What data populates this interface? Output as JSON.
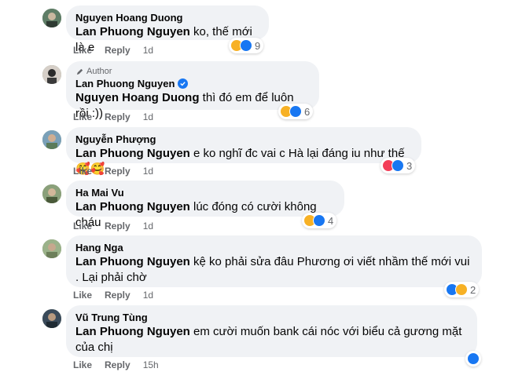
{
  "comments": [
    {
      "name": "Nguyen Hoang Duong",
      "mention": "Lan Phuong Nguyen",
      "text": " ko, thế mới là e",
      "like": "Like",
      "reply": "Reply",
      "time": "1d",
      "count": "9"
    },
    {
      "author_tag": "Author",
      "name": "Lan Phuong Nguyen",
      "mention": "Nguyen Hoang Duong",
      "text": " thì đó em để luôn rồi :))",
      "like": "Like",
      "reply": "Reply",
      "time": "1d",
      "count": "6"
    },
    {
      "name": "Nguyễn Phượng",
      "mention": "Lan Phuong Nguyen",
      "text": " e ko nghĩ đc vai c Hà lại đáng iu như thế 🥰🥰",
      "like": "Like",
      "reply": "Reply",
      "time": "1d",
      "count": "3"
    },
    {
      "name": "Ha Mai Vu",
      "mention": "Lan Phuong Nguyen",
      "text": " lúc đóng có cười không cháu .",
      "like": "Like",
      "reply": "Reply",
      "time": "1d",
      "count": "4"
    },
    {
      "name": "Hang Nga",
      "mention": "Lan Phuong Nguyen",
      "text": " kệ ko phải sửa đâu Phương ơi viết nhầm thế mới vui . Lại phải chờ",
      "like": "Like",
      "reply": "Reply",
      "time": "1d",
      "count": "2"
    },
    {
      "name": "Vũ Trung Tùng",
      "mention": "Lan Phuong Nguyen",
      "text": " em cười muốn bank cái nóc với biểu cả gương mặt của chị",
      "like": "Like",
      "reply": "Reply",
      "time": "15h",
      "count": ""
    }
  ]
}
